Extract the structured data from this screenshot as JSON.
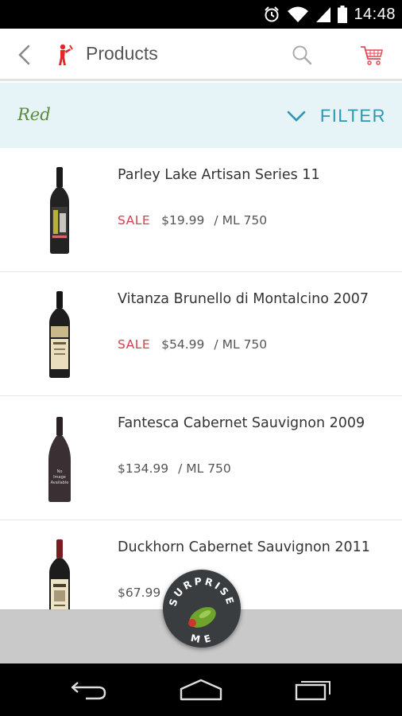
{
  "status_bar": {
    "time": "14:48",
    "icons": [
      "alarm-icon",
      "wifi-icon",
      "cell-signal-icon",
      "battery-icon"
    ]
  },
  "app_bar": {
    "title": "Products",
    "icons": [
      "back-arrow-icon",
      "app-logo-icon",
      "search-icon",
      "cart-icon"
    ]
  },
  "filter_bar": {
    "category": "Red",
    "filter_label": "FILTER"
  },
  "products": [
    {
      "name": "Parley Lake Artisan Series 11",
      "sale": "SALE",
      "price": "$19.99",
      "unit": "/ ML 750"
    },
    {
      "name": "Vitanza Brunello di Montalcino 2007",
      "sale": "SALE",
      "price": "$54.99",
      "unit": "/ ML 750"
    },
    {
      "name": "Fantesca Cabernet Sauvignon 2009",
      "sale": "",
      "price": "$134.99",
      "unit": "/ ML 750",
      "bottle_label": [
        "No",
        "Image",
        "Available"
      ]
    },
    {
      "name": "Duckhorn Cabernet Sauvignon 2011",
      "sale": "",
      "price": "$67.99",
      "unit": ""
    }
  ],
  "fab": {
    "top_text": "SURPRISE",
    "bottom_text": "ME"
  },
  "nav_bar": {
    "icons": [
      "back-icon",
      "home-icon",
      "recents-icon"
    ]
  },
  "colors": {
    "accent": "#2e96b4",
    "sale": "#d6404e",
    "category": "#5b8a3a",
    "filter_bg": "#e6f4f8"
  }
}
